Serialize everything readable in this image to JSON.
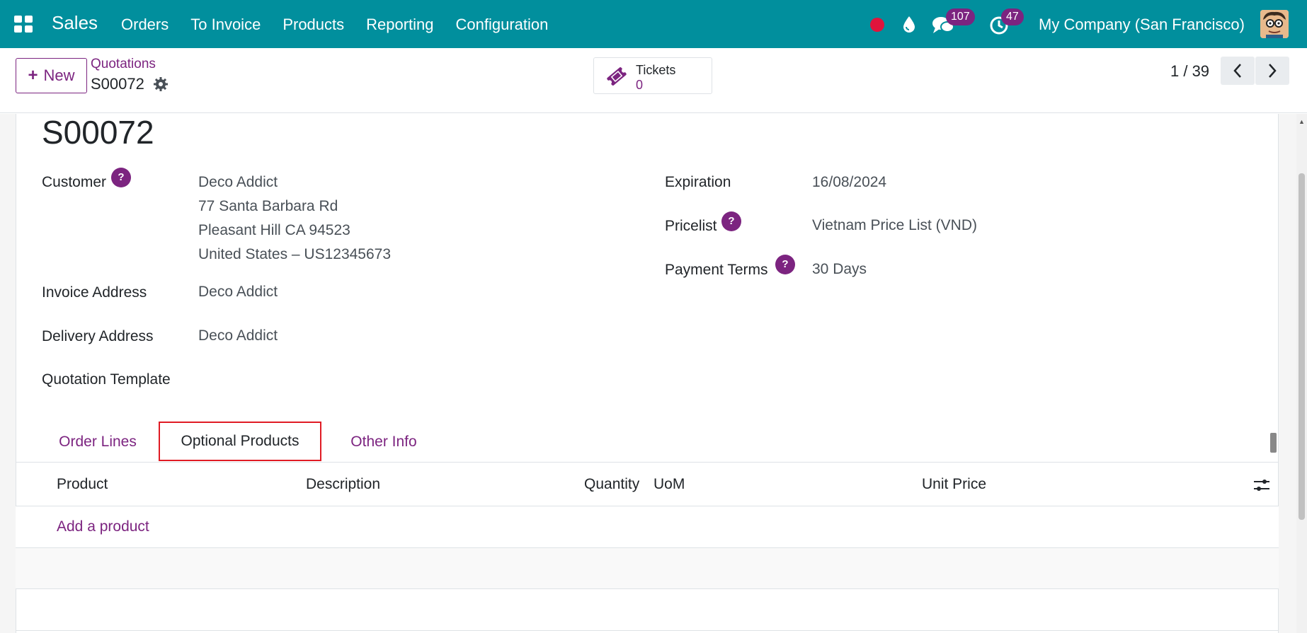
{
  "topbar": {
    "brand": "Sales",
    "menu": [
      "Orders",
      "To Invoice",
      "Products",
      "Reporting",
      "Configuration"
    ],
    "messages_count": "107",
    "activities_count": "47",
    "company": "My Company (San Francisco)",
    "accent_color": "#018f9d"
  },
  "control": {
    "new_label": "New",
    "breadcrumb_parent": "Quotations",
    "breadcrumb_current": "S00072",
    "tickets_label": "Tickets",
    "tickets_value": "0",
    "pager": "1 / 39"
  },
  "record": {
    "title": "S00072",
    "customer_label": "Customer",
    "customer_name": "Deco Addict",
    "customer_address_1": "77 Santa Barbara Rd",
    "customer_address_2": "Pleasant Hill CA 94523",
    "customer_address_3": "United States – US12345673",
    "invoice_label": "Invoice Address",
    "invoice_value": "Deco Addict",
    "delivery_label": "Delivery Address",
    "delivery_value": "Deco Addict",
    "template_label": "Quotation Template",
    "template_value": "",
    "expiration_label": "Expiration",
    "expiration_value": "16/08/2024",
    "pricelist_label": "Pricelist",
    "pricelist_value": "Vietnam Price List (VND)",
    "payment_label": "Payment Terms",
    "payment_value": "30 Days",
    "help_glyph": "?"
  },
  "tabs": [
    {
      "label": "Order Lines",
      "active": false
    },
    {
      "label": "Optional Products",
      "active": true
    },
    {
      "label": "Other Info",
      "active": false
    }
  ],
  "table": {
    "columns": [
      "Product",
      "Description",
      "Quantity",
      "UoM",
      "Unit Price"
    ],
    "add_product": "Add a product"
  },
  "colors": {
    "primary": "#7c2480",
    "highlight": "#e01b24"
  }
}
